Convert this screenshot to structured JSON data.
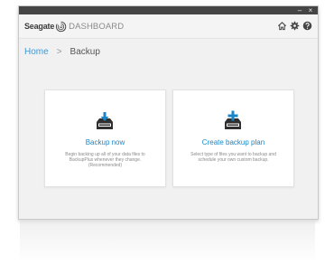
{
  "window": {
    "minimize_glyph": "–",
    "close_glyph": "×"
  },
  "header": {
    "brand_name": "Seagate",
    "product_name": "DASHBOARD",
    "icons": [
      "home-icon",
      "gear-icon",
      "help-icon"
    ]
  },
  "breadcrumb": {
    "home": "Home",
    "separator": ">",
    "current": "Backup"
  },
  "cards": [
    {
      "title": "Backup now",
      "description": "Begin backing up all of your data files to BackupPlus whenever they change. (Recommended)",
      "icon": "backup-now-icon"
    },
    {
      "title": "Create backup plan",
      "description": "Select type of files you want to backup and schedule your own custom backup.",
      "icon": "create-plan-icon"
    }
  ],
  "colors": {
    "accent": "#1a86c8",
    "link": "#3d9ad6",
    "titlebar": "#454545",
    "window_bg": "#f1f1f1",
    "icon_dark": "#2f2f2f"
  }
}
